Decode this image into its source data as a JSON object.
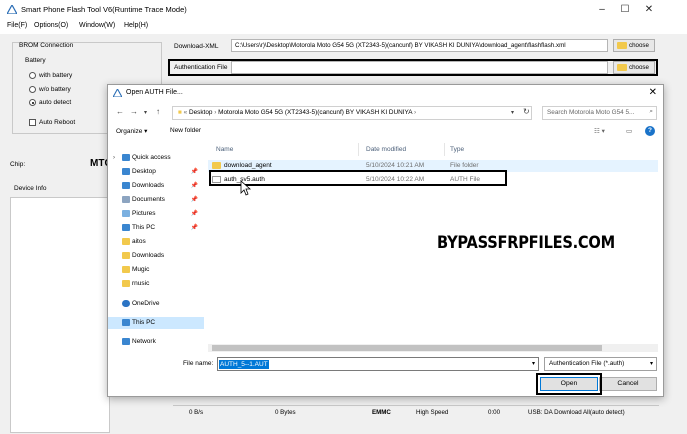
{
  "window": {
    "title": "Smart Phone Flash Tool V6(Runtime Trace Mode)",
    "controls": [
      "–",
      "☐",
      "✕"
    ]
  },
  "menu": [
    "File(F)",
    "Options(O)",
    "Window(W)",
    "Help(H)"
  ],
  "brom": {
    "title": "BROM Connection",
    "battery_label": "Battery",
    "options": [
      "with battery",
      "w/o battery",
      "auto detect"
    ],
    "selected": "auto detect",
    "auto_reboot": "Auto Reboot"
  },
  "chip_label": "Chip:",
  "chip_value": "MTC",
  "device_info_label": "Device Info",
  "download_xml": {
    "label": "Download-XML",
    "value": "C:\\Users\\r)\\Desktop\\Motorola Moto G54 5G  (XT2343-5)(cancunf) BY VIKASH KI DUNIYA\\download_agent\\flashflash.xml",
    "button": "choose"
  },
  "auth_file": {
    "label": "Authentication File",
    "value": "",
    "button": "choose"
  },
  "status": {
    "speed": "0 B/s",
    "bytes": "0 Bytes",
    "storage": "EMMC",
    "mode": "High Speed",
    "time": "0:00",
    "usb": "USB: DA Download All(auto detect)"
  },
  "dialog": {
    "title": "Open AUTH File...",
    "breadcrumb": [
      "Desktop",
      "Motorola Moto G54 5G  (XT2343-5)(cancunf) BY VIKASH KI DUNIYA"
    ],
    "search_placeholder": "Search Motorola Moto G54 5...",
    "organize": "Organize ▾",
    "new_folder": "New folder",
    "nav": [
      {
        "label": "Quick access",
        "icon": "star-icon",
        "color": "#3a86d0",
        "pin": false
      },
      {
        "label": "Desktop",
        "icon": "desktop-icon",
        "color": "#3a86d0",
        "pin": true
      },
      {
        "label": "Downloads",
        "icon": "download-icon",
        "color": "#3a86d0",
        "pin": true
      },
      {
        "label": "Documents",
        "icon": "documents-icon",
        "color": "#8ca4c0",
        "pin": true
      },
      {
        "label": "Pictures",
        "icon": "pictures-icon",
        "color": "#7bb0e0",
        "pin": true
      },
      {
        "label": "This PC",
        "icon": "computer-icon",
        "color": "#3a86d0",
        "pin": true
      },
      {
        "label": "aitos",
        "icon": "folder-icon",
        "color": "#f2c94c",
        "pin": false
      },
      {
        "label": "Downloads",
        "icon": "folder-icon",
        "color": "#f2c94c",
        "pin": false
      },
      {
        "label": "Mugic",
        "icon": "folder-icon",
        "color": "#f2c94c",
        "pin": false
      },
      {
        "label": "rnusic",
        "icon": "folder-icon",
        "color": "#f2c94c",
        "pin": false
      },
      {
        "label": "OneDrive",
        "icon": "onedrive-icon",
        "color": "#2b74c4",
        "pin": false
      },
      {
        "label": "This PC",
        "icon": "computer-icon",
        "color": "#3a86d0",
        "pin": false
      },
      {
        "label": "Network",
        "icon": "network-icon",
        "color": "#3a86d0",
        "pin": false
      }
    ],
    "columns": [
      "Name",
      "Date modified",
      "Type"
    ],
    "files": [
      {
        "name": "download_agent",
        "date": "5/10/2024 10:21 AM",
        "type": "File folder",
        "kind": "folder"
      },
      {
        "name": "auth_sv5.auth",
        "date": "5/10/2024 10:22 AM",
        "type": "AUTH File",
        "kind": "file"
      }
    ],
    "file_name_label": "File name:",
    "file_name_value": "AUTH_5--1.AUT",
    "file_type": "Authentication File (*.auth)",
    "open": "Open",
    "cancel": "Cancel"
  },
  "watermark": "BYPASSFRPFILES.COM"
}
